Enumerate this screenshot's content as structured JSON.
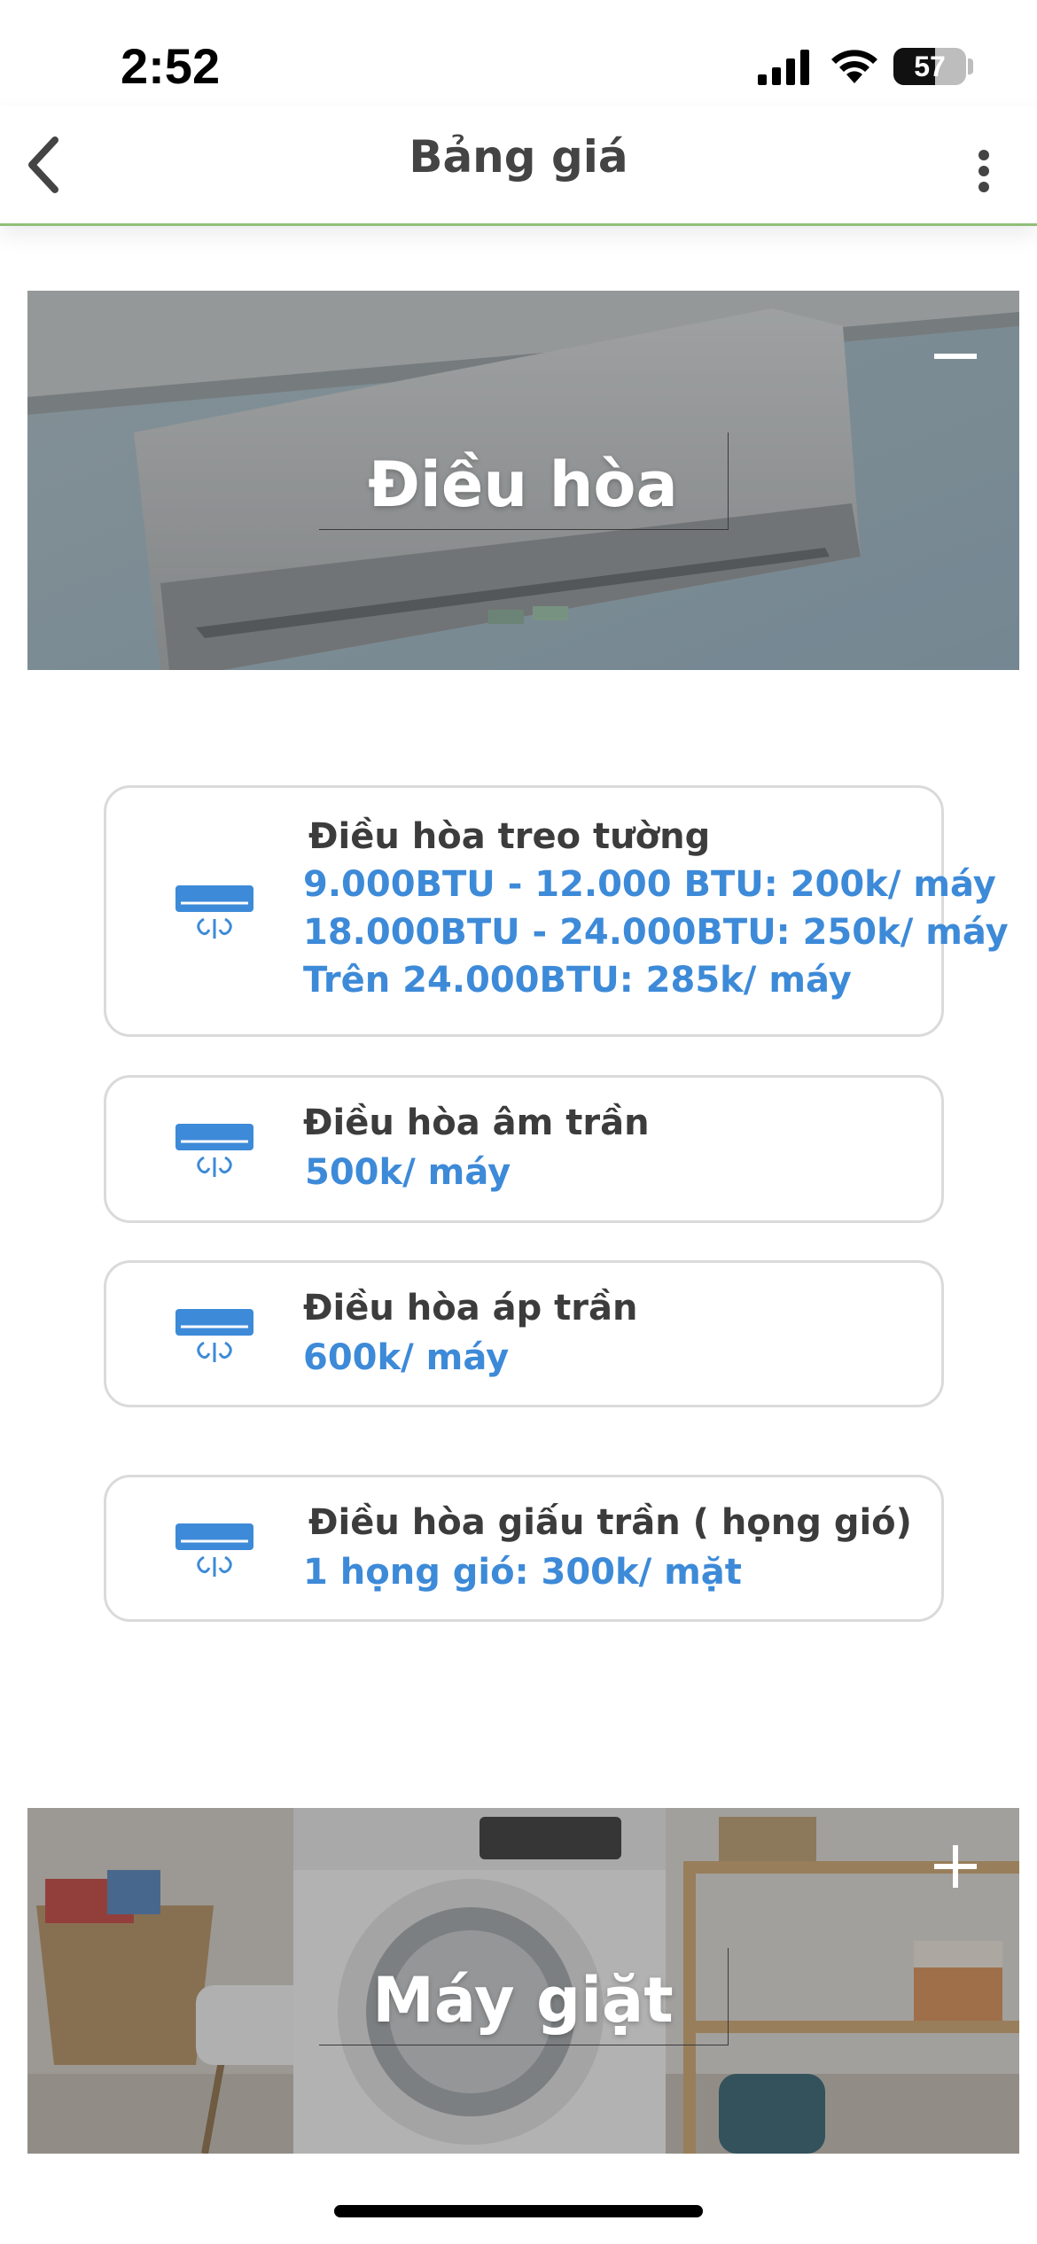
{
  "status_bar": {
    "time": "2:52",
    "battery": "57",
    "battery_level": 0.57
  },
  "header": {
    "title": "Bảng giá"
  },
  "sections": [
    {
      "title": "Điều hòa",
      "toggle": "minus-icon",
      "expanded": true,
      "items": [
        {
          "title": "Điều hòa treo tường",
          "prices": [
            "9.000BTU - 12.000 BTU: 200k/ máy",
            "18.000BTU - 24.000BTU: 250k/ máy",
            "Trên 24.000BTU: 285k/ máy"
          ]
        },
        {
          "title": "Điều hòa âm trần",
          "prices": [
            "500k/ máy"
          ]
        },
        {
          "title": "Điều hòa áp trần",
          "prices": [
            "600k/ máy"
          ]
        },
        {
          "title": "Điều hòa giấu trần ( họng gió)",
          "prices": [
            "1 họng gió: 300k/ mặt"
          ]
        }
      ]
    },
    {
      "title": "Máy giặt",
      "toggle": "plus-icon",
      "expanded": false
    }
  ],
  "colors": {
    "accent_blue": "#3d8ad8",
    "header_divider": "#8fbf7a",
    "card_border": "#dadada"
  }
}
